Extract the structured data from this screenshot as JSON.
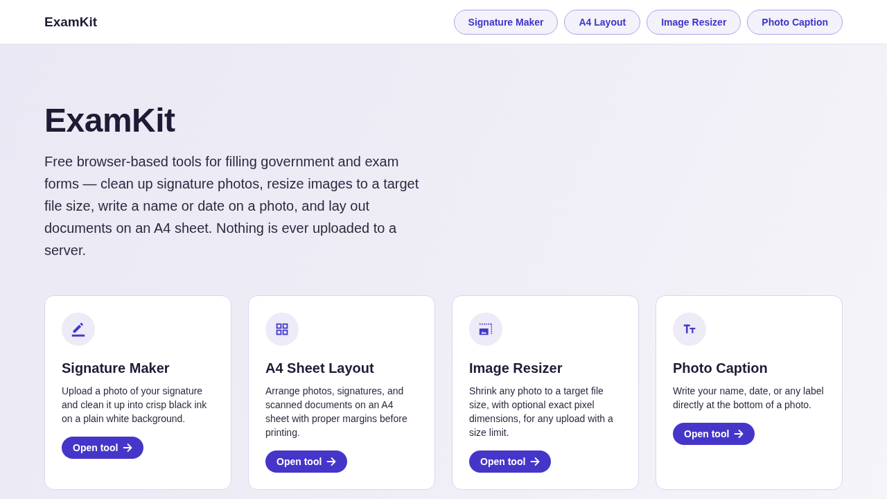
{
  "header": {
    "logo": "ExamKit",
    "nav": [
      "Signature Maker",
      "A4 Layout",
      "Image Resizer",
      "Photo Caption"
    ]
  },
  "hero": {
    "title": "ExamKit",
    "description": "Free browser-based tools for filling government and exam forms — clean up signature photos, resize images to a target file size, write a name or date on a photo, and lay out documents on an A4 sheet. Nothing is ever uploaded to a server."
  },
  "tools": [
    {
      "kind": "pencil",
      "title": "Signature Maker",
      "description": "Upload a photo of your signature and clean it up into crisp black ink on a plain white background.",
      "button": "Open tool"
    },
    {
      "kind": "grid",
      "title": "A4 Sheet Layout",
      "description": "Arrange photos, signatures, and scanned documents on an A4 sheet with proper margins before printing.",
      "button": "Open tool"
    },
    {
      "kind": "resize",
      "title": "Image Resizer",
      "description": "Shrink any photo to a target file size, with optional exact pixel dimensions, for any upload with a size limit.",
      "button": "Open tool"
    },
    {
      "kind": "text",
      "title": "Photo Caption",
      "description": "Write your name, date, or any label directly at the bottom of a photo.",
      "button": "Open tool"
    }
  ]
}
